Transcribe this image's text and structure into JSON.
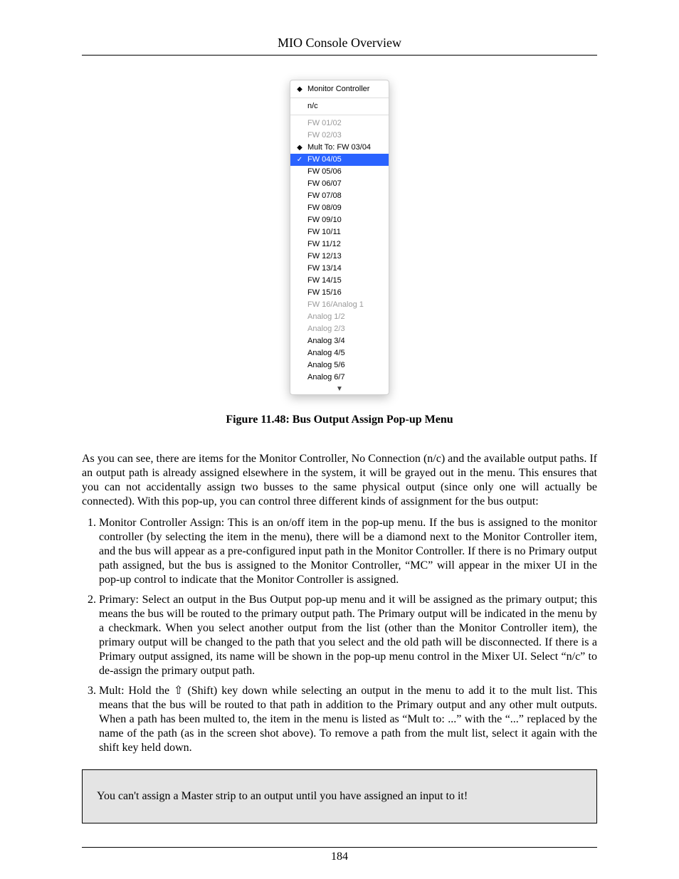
{
  "header": {
    "title": "MIO Console Overview"
  },
  "menu": {
    "items": [
      {
        "label": "Monitor Controller",
        "mark": "diamond",
        "disabled": false,
        "selected": false
      },
      {
        "sep": true
      },
      {
        "label": "n/c",
        "mark": "",
        "disabled": false,
        "selected": false
      },
      {
        "sep": true
      },
      {
        "label": "FW 01/02",
        "mark": "",
        "disabled": true,
        "selected": false
      },
      {
        "label": "FW 02/03",
        "mark": "",
        "disabled": true,
        "selected": false
      },
      {
        "label": "Mult To: FW 03/04",
        "mark": "diamond",
        "disabled": false,
        "selected": false
      },
      {
        "label": "FW 04/05",
        "mark": "check",
        "disabled": false,
        "selected": true
      },
      {
        "label": "FW 05/06",
        "mark": "",
        "disabled": false,
        "selected": false
      },
      {
        "label": "FW 06/07",
        "mark": "",
        "disabled": false,
        "selected": false
      },
      {
        "label": "FW 07/08",
        "mark": "",
        "disabled": false,
        "selected": false
      },
      {
        "label": "FW 08/09",
        "mark": "",
        "disabled": false,
        "selected": false
      },
      {
        "label": "FW 09/10",
        "mark": "",
        "disabled": false,
        "selected": false
      },
      {
        "label": "FW 10/11",
        "mark": "",
        "disabled": false,
        "selected": false
      },
      {
        "label": "FW 11/12",
        "mark": "",
        "disabled": false,
        "selected": false
      },
      {
        "label": "FW 12/13",
        "mark": "",
        "disabled": false,
        "selected": false
      },
      {
        "label": "FW 13/14",
        "mark": "",
        "disabled": false,
        "selected": false
      },
      {
        "label": "FW 14/15",
        "mark": "",
        "disabled": false,
        "selected": false
      },
      {
        "label": "FW 15/16",
        "mark": "",
        "disabled": false,
        "selected": false
      },
      {
        "label": "FW 16/Analog 1",
        "mark": "",
        "disabled": true,
        "selected": false
      },
      {
        "label": "Analog 1/2",
        "mark": "",
        "disabled": true,
        "selected": false
      },
      {
        "label": "Analog 2/3",
        "mark": "",
        "disabled": true,
        "selected": false
      },
      {
        "label": "Analog 3/4",
        "mark": "",
        "disabled": false,
        "selected": false
      },
      {
        "label": "Analog 4/5",
        "mark": "",
        "disabled": false,
        "selected": false
      },
      {
        "label": "Analog 5/6",
        "mark": "",
        "disabled": false,
        "selected": false
      },
      {
        "label": "Analog 6/7",
        "mark": "",
        "disabled": false,
        "selected": false
      }
    ]
  },
  "caption": "Figure 11.48: Bus Output Assign Pop-up Menu",
  "paragraph": "As you can see, there are items for the Monitor Controller, No Connection (n/c) and the available output paths. If an output path is already assigned elsewhere in the system, it will be grayed out in the menu. This ensures that you can not accidentally assign two busses to the same physical output (since only one will actually be connected). With this pop-up, you can control three different kinds of assignment for the bus output:",
  "list": [
    "Monitor Controller Assign: This is an on/off item in the pop-up menu. If the bus is assigned to the monitor controller (by selecting the item in the menu), there will be a diamond next to the Monitor Controller item, and the bus will appear as a pre-configured input path in the Monitor Controller. If there is no Primary output path assigned, but the bus is assigned to the Monitor Controller, “MC” will appear in the mixer UI in the pop-up control to indicate that the Monitor Controller is assigned.",
    "Primary: Select an output in the Bus Output pop-up menu and it will be assigned as the primary output; this means the bus will be routed to the primary output path. The Primary output will be indicated in the menu by a checkmark. When you select another output from the list (other than the Monitor Controller item), the primary output will be changed to the path that you select and the old path will be disconnected. If there is a Primary output assigned, its name will be shown in the pop-up menu control in the Mixer UI. Select “n/c” to de-assign the primary output path.",
    "Mult: Hold the ⇧ (Shift) key down while selecting an output in the menu to add it to the mult list. This means that the bus will be routed to that path in addition to the Primary output and any other mult outputs. When a path has been multed to, the item in the menu is listed as “Mult to: ...” with the “...” replaced by the name of the path (as in the screen shot above). To remove a path from the mult list, select it again with the shift key held down."
  ],
  "note": "You can't assign a Master strip to an output until you have assigned an input to it!",
  "footer": {
    "page_number": "184"
  }
}
